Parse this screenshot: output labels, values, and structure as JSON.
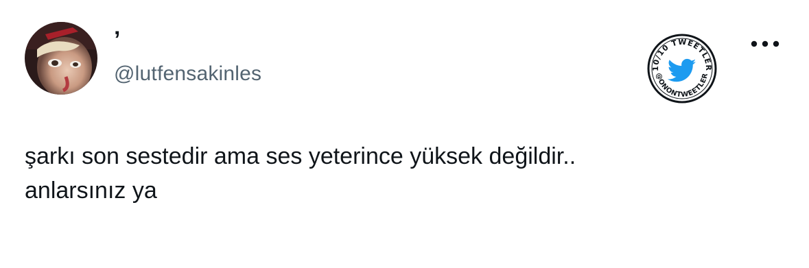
{
  "tweet": {
    "author": {
      "display_name": "’",
      "handle": "@lutfensakinles"
    },
    "text_lines": [
      "şarkı son sestedir ama ses yeterince yüksek değildir..",
      "anlarsınız ya"
    ]
  },
  "badge": {
    "top_text": "10/10 TWEETLER",
    "bottom_text": "@ONONTWEETLER",
    "icon": "twitter-bird-icon",
    "bird_color": "#1d9bf0"
  },
  "actions": {
    "more_icon": "more-horizontal-icon"
  },
  "colors": {
    "text": "#0f1419",
    "secondary": "#536471"
  }
}
